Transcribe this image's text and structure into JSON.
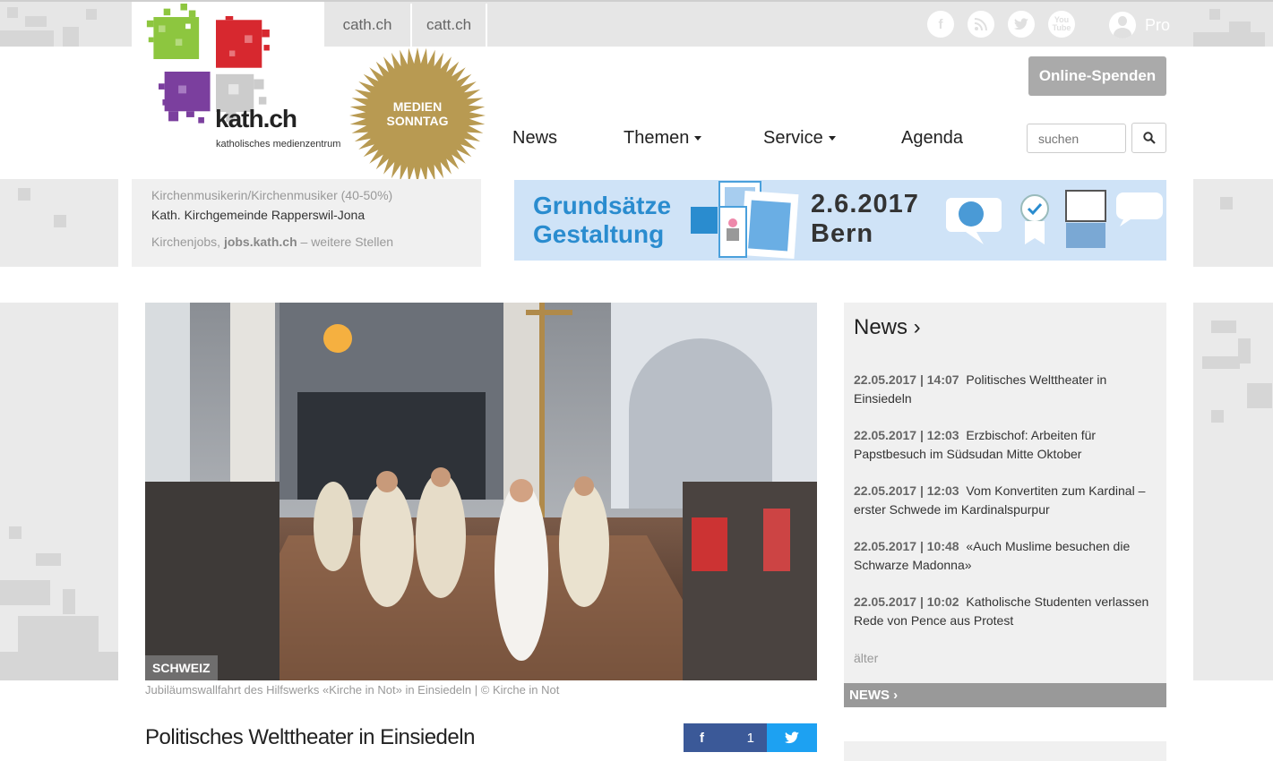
{
  "topbar": {
    "links": [
      "cath.ch",
      "catt.ch"
    ],
    "social_icons": [
      "facebook-icon",
      "rss-icon",
      "twitter-icon",
      "youtube-icon"
    ],
    "pro_label": "Pro"
  },
  "logo": {
    "title": "kath.ch",
    "subtitle": "katholisches medienzentrum",
    "colors": [
      "#8dc63f",
      "#d7282f",
      "#7b3f9e",
      "#cccccc"
    ]
  },
  "badge": {
    "line1": "MEDIEN",
    "line2": "SONNTAG",
    "color": "#b89a52"
  },
  "header": {
    "donate_label": "Online-Spenden",
    "nav": [
      {
        "label": "News",
        "dropdown": false
      },
      {
        "label": "Themen",
        "dropdown": true
      },
      {
        "label": "Service",
        "dropdown": true
      },
      {
        "label": "Agenda",
        "dropdown": false
      }
    ],
    "search_placeholder": "suchen"
  },
  "jobs": {
    "title": "Kirchenmusikerin/Kirchenmusiker (40-50%)",
    "employer": "Kath. Kirchgemeinde Rapperswil-Jona",
    "footer_prefix": "Kirchenjobs,",
    "footer_link": "jobs.kath.ch",
    "footer_suffix": "– weitere Stellen"
  },
  "banner": {
    "line1": "Grundsätze",
    "line2": "Gestaltung",
    "date": "2.6.2017",
    "place": "Bern"
  },
  "main": {
    "category": "SCHWEIZ",
    "caption": "Jubiläumswallfahrt des Hilfswerks «Kirche in Not» in Einsiedeln | © Kirche in Not",
    "title": "Politisches Welttheater in Einsiedeln",
    "fb_count": "1"
  },
  "news": {
    "heading": "News ›",
    "items": [
      {
        "meta": "22.05.2017 | 14:07",
        "text": "Politisches Welttheater in Einsiedeln"
      },
      {
        "meta": "22.05.2017 | 12:03",
        "text": "Erzbischof: Arbeiten für Papstbesuch im Südsudan Mitte Oktober"
      },
      {
        "meta": "22.05.2017 | 12:03",
        "text": "Vom Konvertiten zum Kardinal – erster Schwede im Kardinalspurpur"
      },
      {
        "meta": "22.05.2017 | 10:48",
        "text": "«Auch Muslime besuchen die Schwarze Madonna»"
      },
      {
        "meta": "22.05.2017 | 10:02",
        "text": "Katholische Studenten verlassen Rede von Pence aus Protest"
      }
    ],
    "older": "älter",
    "footer": "NEWS ›"
  }
}
